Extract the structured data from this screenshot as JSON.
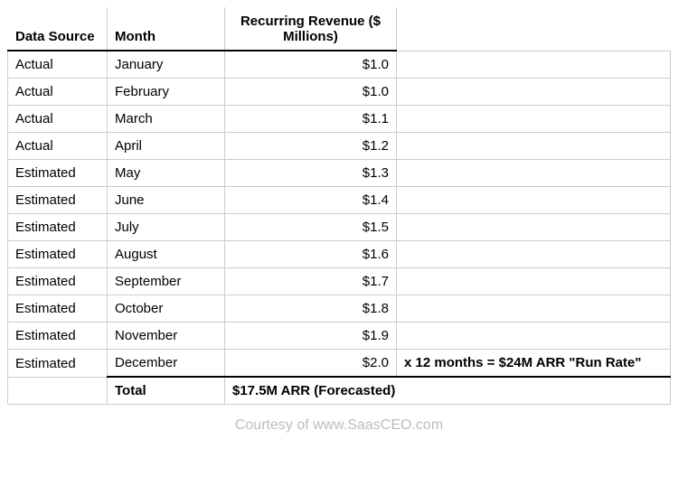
{
  "headers": {
    "source": "Data Source",
    "month": "Month",
    "revenue": "Recurring Revenue ($ Millions)"
  },
  "rows": [
    {
      "source": "Actual",
      "month": "January",
      "revenue": "$1.0",
      "note": ""
    },
    {
      "source": "Actual",
      "month": "February",
      "revenue": "$1.0",
      "note": ""
    },
    {
      "source": "Actual",
      "month": "March",
      "revenue": "$1.1",
      "note": ""
    },
    {
      "source": "Actual",
      "month": "April",
      "revenue": "$1.2",
      "note": ""
    },
    {
      "source": "Estimated",
      "month": "May",
      "revenue": "$1.3",
      "note": ""
    },
    {
      "source": "Estimated",
      "month": "June",
      "revenue": "$1.4",
      "note": ""
    },
    {
      "source": "Estimated",
      "month": "July",
      "revenue": "$1.5",
      "note": ""
    },
    {
      "source": "Estimated",
      "month": "August",
      "revenue": "$1.6",
      "note": ""
    },
    {
      "source": "Estimated",
      "month": "September",
      "revenue": "$1.7",
      "note": ""
    },
    {
      "source": "Estimated",
      "month": "October",
      "revenue": "$1.8",
      "note": ""
    },
    {
      "source": "Estimated",
      "month": "November",
      "revenue": "$1.9",
      "note": ""
    },
    {
      "source": "Estimated",
      "month": "December",
      "revenue": "$2.0",
      "note": "x 12 months = $24M ARR \"Run Rate\""
    }
  ],
  "total": {
    "label": "Total",
    "value": "$17.5M ARR (Forecasted)"
  },
  "footer": "Courtesy of www.SaasCEO.com",
  "chart_data": {
    "type": "table",
    "title": "Recurring Revenue ($ Millions) by Month",
    "columns": [
      "Data Source",
      "Month",
      "Recurring Revenue ($ Millions)"
    ],
    "categories": [
      "January",
      "February",
      "March",
      "April",
      "May",
      "June",
      "July",
      "August",
      "September",
      "October",
      "November",
      "December"
    ],
    "values": [
      1.0,
      1.0,
      1.1,
      1.2,
      1.3,
      1.4,
      1.5,
      1.6,
      1.7,
      1.8,
      1.9,
      2.0
    ],
    "annotations": {
      "december_run_rate": "x 12 months = $24M ARR \"Run Rate\"",
      "total_forecasted": "$17.5M ARR (Forecasted)"
    }
  }
}
